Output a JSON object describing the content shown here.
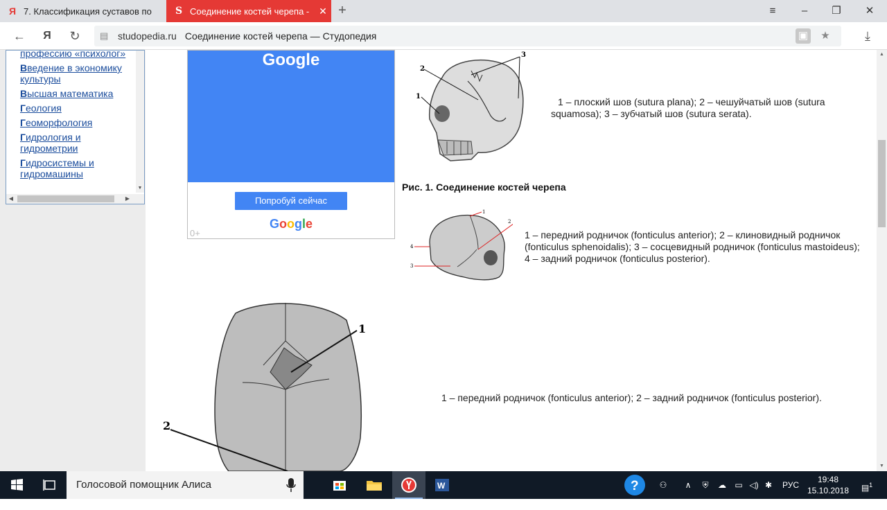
{
  "browser": {
    "tabs": [
      {
        "label": "7. Классификация суставов по"
      },
      {
        "label": "Соединение костей черепа -",
        "active": true
      }
    ],
    "address": {
      "domain": "studopedia.ru",
      "page_title": "Соединение костей черепа — Студопедия"
    }
  },
  "sidebar": {
    "items": [
      {
        "first": "",
        "rest": "профессию «психолог»"
      },
      {
        "first": "В",
        "rest": "ведение в экономику культуры"
      },
      {
        "first": "В",
        "rest": "ысшая математика"
      },
      {
        "first": "Г",
        "rest": "еология"
      },
      {
        "first": "Г",
        "rest": "еоморфология"
      },
      {
        "first": "Г",
        "rest": "идрология и гидрометрии"
      },
      {
        "first": "Г",
        "rest": "идросистемы и гидромашины"
      }
    ]
  },
  "ad": {
    "brand": "Google",
    "cta": "Попробуй сейчас",
    "brand_bottom": [
      "G",
      "o",
      "o",
      "g",
      "l",
      "e"
    ],
    "age": "0+"
  },
  "article": {
    "fig1_labels": [
      "1",
      "2",
      "3"
    ],
    "caption1": "1 – плоский шов (sutura plana); 2 – чешуйчатый шов (sutura squamosa); 3 – зубчатый шов (sutura serata).",
    "fig_title": "Рис. 1. Соединение костей черепа",
    "fig2_labels": [
      "1",
      "2",
      "3",
      "4"
    ],
    "caption2": "1 – передний родничок (fonticulus anterior); 2 – клиновидный родничок (fonticulus sphenoidalis); 3 – сосцевидный родничок (fonticulus mastoideus); 4 – задний родничок (fonticulus posterior).",
    "fig3_labels": [
      "1",
      "2"
    ],
    "caption3": "1 – передний родничок (fonticulus anterior); 2 – задний родничок (fonticulus posterior)."
  },
  "taskbar": {
    "search_text": "Голосовой помощник Алиса",
    "lang": "РУС",
    "time": "19:48",
    "date": "15.10.2018",
    "notifications": "1"
  },
  "colors": {
    "yandex_red": "#e53935",
    "google_blue": "#4285f4",
    "link": "#1a4c9c",
    "taskbar": "#101a26"
  }
}
